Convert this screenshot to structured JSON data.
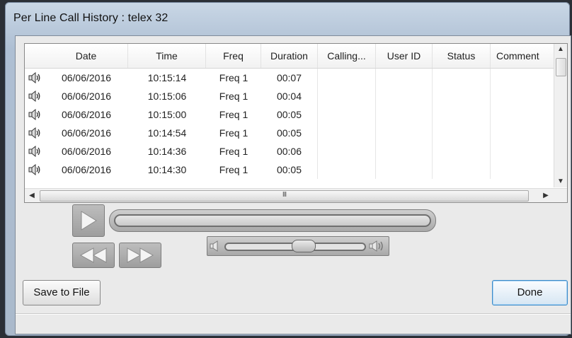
{
  "window": {
    "title": "Per Line Call History : telex 32"
  },
  "table": {
    "columns": [
      "",
      "Date",
      "Time",
      "Freq",
      "Duration",
      "Calling...",
      "User ID",
      "Status",
      "Comment"
    ],
    "rows": [
      {
        "icon": "speaker-icon",
        "date": "06/06/2016",
        "time": "10:15:14",
        "freq": "Freq 1",
        "duration": "00:07"
      },
      {
        "icon": "speaker-icon",
        "date": "06/06/2016",
        "time": "10:15:06",
        "freq": "Freq 1",
        "duration": "00:04"
      },
      {
        "icon": "speaker-icon",
        "date": "06/06/2016",
        "time": "10:15:00",
        "freq": "Freq 1",
        "duration": "00:05"
      },
      {
        "icon": "speaker-icon",
        "date": "06/06/2016",
        "time": "10:14:54",
        "freq": "Freq 1",
        "duration": "00:05"
      },
      {
        "icon": "speaker-icon",
        "date": "06/06/2016",
        "time": "10:14:36",
        "freq": "Freq 1",
        "duration": "00:06"
      },
      {
        "icon": "speaker-icon",
        "date": "06/06/2016",
        "time": "10:14:30",
        "freq": "Freq 1",
        "duration": "00:05"
      }
    ],
    "hscroll_grip": "III"
  },
  "player": {
    "play_icon": "play-icon",
    "rewind_icon": "rewind-icon",
    "fast_forward_icon": "fast-forward-icon",
    "volume_level": 0.58
  },
  "buttons": {
    "save": "Save to File",
    "done": "Done"
  },
  "colors": {
    "focus_border": "#3b8ac9",
    "button_gray": "#a9a9a9"
  }
}
